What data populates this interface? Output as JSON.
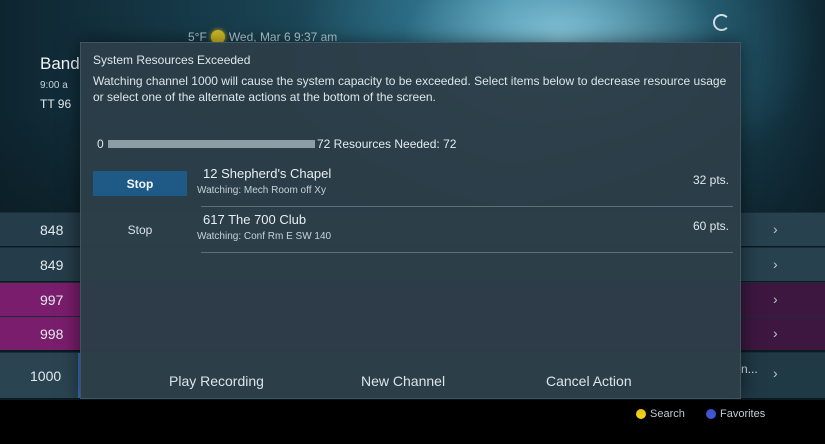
{
  "header": {
    "temperature": "5°F",
    "datetime": "Wed, Mar 6 9:37 am",
    "show_title": "Band",
    "show_time": "9:00 a",
    "show_rating": "TT 96"
  },
  "guide": {
    "rows": [
      {
        "channel": "848",
        "tail": ""
      },
      {
        "channel": "849",
        "tail": ""
      },
      {
        "channel": "997",
        "tail": ""
      },
      {
        "channel": "998",
        "tail": ""
      },
      {
        "channel": "1000",
        "tail": "n..."
      }
    ],
    "arrow": "›"
  },
  "legend": {
    "search_label": "Search",
    "favorites_label": "Favorites"
  },
  "dialog": {
    "title": "System Resources Exceeded",
    "message": "Watching channel 1000 will cause the system capacity to be exceeded. Select items below to decrease resource usage or select one of the alternate actions at the bottom of the screen.",
    "resource_min": "0",
    "resource_needed_value": "72",
    "resource_label": "72  Resources Needed: 72",
    "resource_progress": 1.0,
    "items": [
      {
        "button": "Stop",
        "name": "12  Shepherd's Chapel",
        "watching": "Watching: Mech Room off Xy",
        "points": "32 pts."
      },
      {
        "button": "Stop",
        "name": "617  The 700 Club",
        "watching": "Watching: Conf Rm E SW 140",
        "points": "60 pts."
      }
    ],
    "actions": {
      "play_recording": "Play Recording",
      "new_channel": "New Channel",
      "cancel_action": "Cancel Action"
    }
  },
  "colors": {
    "focus_blue": "#1f5a86",
    "purple_row": "#7a1d6c",
    "dialog_bg": "#2c3e48",
    "yellow_dot": "#f5d21b",
    "blue_dot": "#4458d9"
  }
}
